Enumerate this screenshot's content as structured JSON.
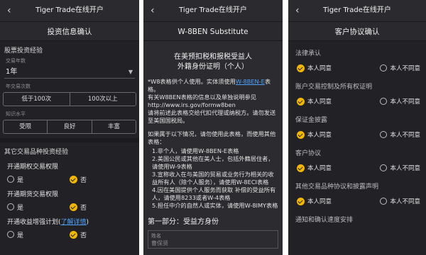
{
  "app_title": "Tiger Trade在线开户",
  "panel1": {
    "subtitle": "投资信息确认",
    "section_title": "股票投资经验",
    "years_label": "交易年数",
    "years_value": "1年",
    "frequency_label": "年交易次数",
    "frequency_options": [
      "低于100次",
      "100次以上"
    ],
    "knowledge_label": "知识水平",
    "knowledge_options": [
      "受限",
      "良好",
      "丰富"
    ],
    "other_title": "其它交易品种投资经验",
    "questions": [
      {
        "text": "开通期权交易权限",
        "yes": "是",
        "no": "否",
        "selected": "no"
      },
      {
        "text": "开通期货交易权限",
        "yes": "是",
        "no": "否",
        "selected": "no"
      },
      {
        "text": "开通收益增强计划(",
        "link": "了解详情",
        "suffix": ")",
        "yes": "是",
        "no": "否",
        "selected": "no"
      }
    ]
  },
  "panel2": {
    "subtitle": "W-8BEN Substitute",
    "doc_title_line1": "在美预扣税和报税受益人",
    "doc_title_line2": "外籍身份证明（个人）",
    "intro_prefix": "*W8表格供个人使用。实体须使用",
    "intro_link": "W-8BEN-E",
    "intro_suffix": "表格。",
    "info_line1": "有关W8BEN表格的信息以及单独说明参见",
    "info_url": "http://www.irs.gov/formw8ben",
    "info_line2": "请将前述此表格交给代扣代理或纳税方。请勿发送至美国国税局。",
    "cond_intro": "如果属于以下情况，请勿使用此表格，而使用其他表格：",
    "items": [
      "1.非个人，请使用W-8BEN-E表格",
      "2.美国公民或其他在美人士，包括外籍居住者，请使用W-9表格",
      "3.宣称收入在与美国的贸易或业务行为相关的收益所有人（除个人服务），请使用W-8ECI表格",
      "4.因在美国提供个人服务而获取 补偿的受益所有人，请使用8233或者W-4表格",
      "5.担任中介的自然人或实体，请使用W-8IMY表格"
    ],
    "part_title": "第一部分：受益方身份",
    "field_label": "姓名",
    "field_placeholder": "曹保贤"
  },
  "panel3": {
    "subtitle": "客户协议确认",
    "agreements": [
      {
        "title": "法律承认",
        "agree": "本人同意",
        "disagree": "本人不同意",
        "selected": "agree"
      },
      {
        "title": "账户交易控制及所有权证明",
        "agree": "本人同意",
        "disagree": "本人不同意",
        "selected": "agree"
      },
      {
        "title": "保证金披露",
        "agree": "本人同意",
        "disagree": "本人不同意",
        "selected": "agree"
      },
      {
        "title": "客户协议",
        "agree": "本人同意",
        "disagree": "本人不同意",
        "selected": "agree"
      },
      {
        "title": "其他交易品种协议和披露声明",
        "agree": "本人同意",
        "disagree": "本人不同意",
        "selected": "agree"
      }
    ],
    "partial_title": "通知和确认速度安排"
  },
  "colors": {
    "accent": "#f2b705",
    "link": "#4ea3ff",
    "background": "#222125"
  }
}
